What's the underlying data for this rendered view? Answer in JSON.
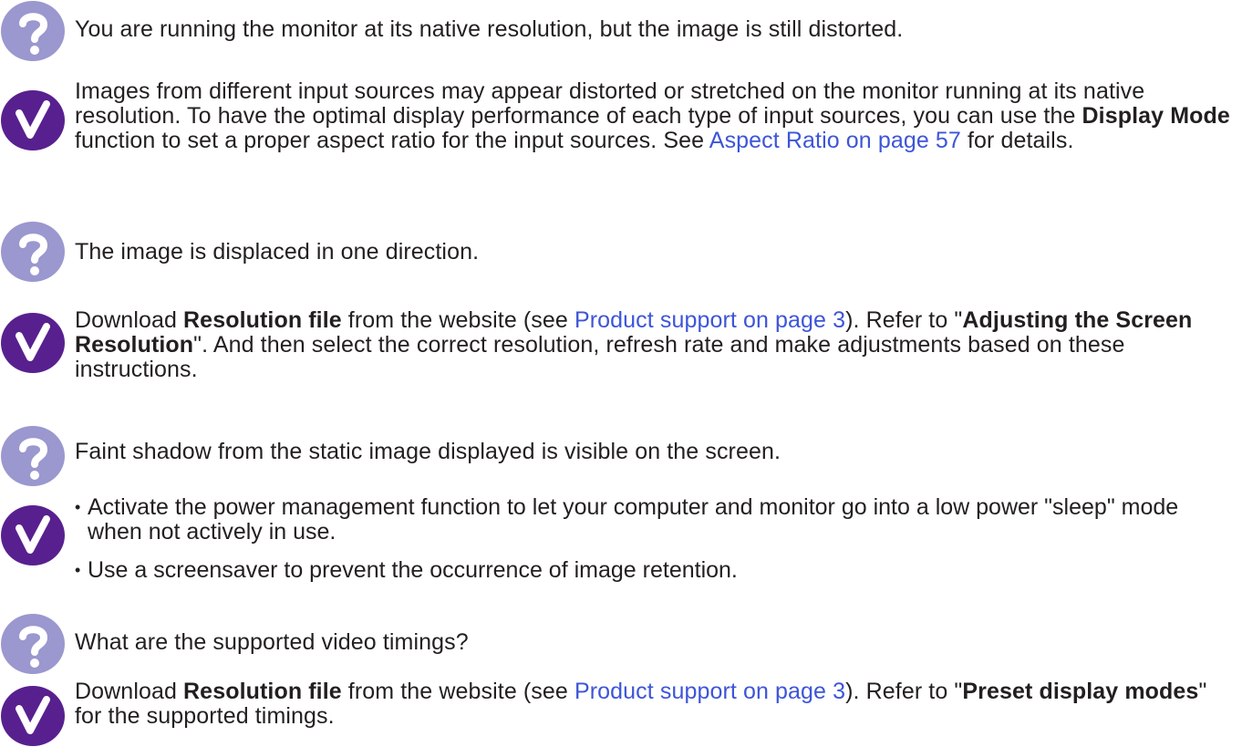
{
  "colors": {
    "question_icon": "#9b97cf",
    "answer_icon": "#58208f",
    "link": "#3d55d8",
    "text": "#231f20"
  },
  "icons": {
    "question": "question-mark-icon",
    "answer": "checkmark-icon"
  },
  "faq": [
    {
      "question": "You are running the monitor at its native resolution, but the image is still distorted.",
      "answer": {
        "p1": "Images from different input sources may appear distorted or stretched on the monitor running at its native resolution. To have the optimal display performance of each type of input sources, you can use the ",
        "b1": "Display Mode",
        "p2": " function to set a proper aspect ratio for the input sources. See ",
        "link": "Aspect Ratio on page 57",
        "p3": " for details."
      }
    },
    {
      "question": "The image is displaced in one direction.",
      "answer": {
        "p1": "Download ",
        "b1": "Resolution file",
        "p2": " from the website (see ",
        "link": "Product support on page 3",
        "p3": "). Refer to \"",
        "b2": "Adjusting the Screen Resolution",
        "p4": "\". And then select the correct resolution, refresh rate and make adjustments based on these instructions."
      }
    },
    {
      "question": "Faint shadow from the static image displayed is visible on the screen.",
      "answer": {
        "bullets": [
          "Activate the power management function to let your computer and monitor go into a low power \"sleep\" mode when not actively in use.",
          "Use a screensaver to prevent the occurrence of image retention."
        ]
      }
    },
    {
      "question": "What are the supported video timings?",
      "answer": {
        "p1": "Download ",
        "b1": "Resolution file",
        "p2": " from the website (see ",
        "link": "Product support on page 3",
        "p3": "). Refer to \"",
        "b2": "Preset display modes",
        "p4": "\" for the supported timings."
      }
    }
  ]
}
